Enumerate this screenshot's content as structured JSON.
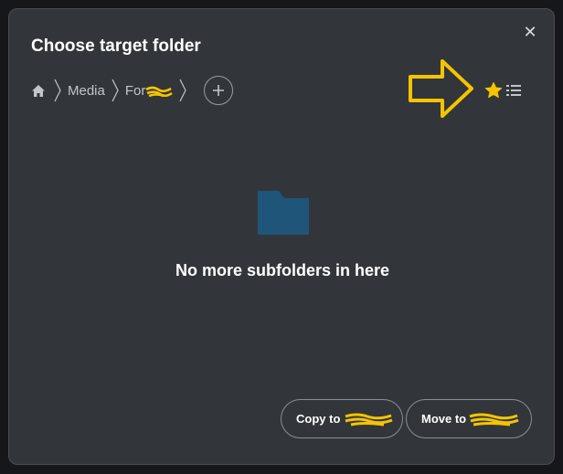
{
  "dialog": {
    "title": "Choose target folder",
    "close_glyph": "✕"
  },
  "breadcrumb": {
    "home_icon": "home-icon",
    "items": [
      {
        "label": "Media"
      },
      {
        "label": "For"
      }
    ],
    "add_glyph": "+"
  },
  "view_controls": {
    "favorite_icon": "star-icon",
    "list_icon": "list-icon",
    "accent_color": "#f5c400"
  },
  "empty_state": {
    "icon": "folder-icon",
    "message": "No more subfolders in here",
    "folder_color": "#1f5578"
  },
  "actions": {
    "copy_label": "Copy to",
    "move_label": "Move to"
  },
  "annotation": {
    "color": "#f5c400"
  }
}
